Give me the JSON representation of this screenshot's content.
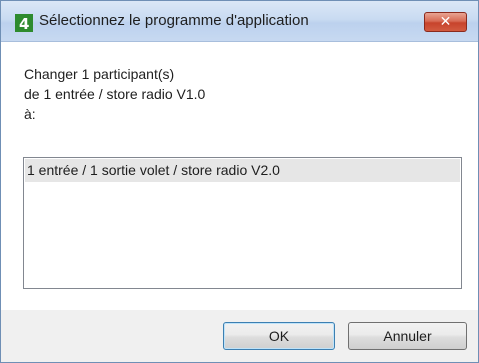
{
  "window": {
    "title": "Sélectionnez le programme d'application",
    "close_glyph": "✕"
  },
  "message": {
    "line1": "Changer 1 participant(s)",
    "line2": "de 1 entrée /  store radio V1.0",
    "line3": "à:"
  },
  "list": {
    "items": [
      {
        "label": "1 entrée / 1 sortie volet / store radio V2.0",
        "selected": true
      }
    ]
  },
  "buttons": {
    "ok_label": "OK",
    "cancel_label": "Annuler"
  },
  "colors": {
    "title_icon_green": "#2e8b2e",
    "close_red": "#c7432c",
    "ok_focus_border": "#3c7fb1"
  }
}
